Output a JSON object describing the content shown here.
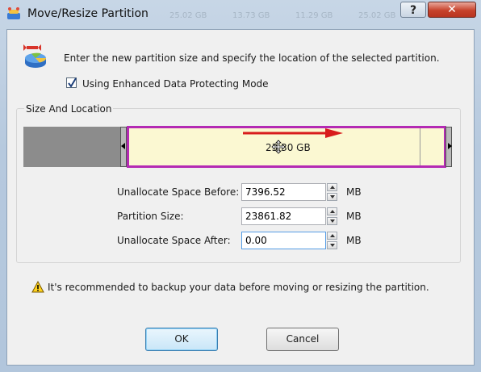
{
  "window": {
    "title": "Move/Resize Partition",
    "help_label": "?",
    "close_label": "✕",
    "background_ghost_values": [
      "25.02 GB",
      "13.73 GB",
      "11.29 GB",
      "25.02 GB"
    ]
  },
  "header": {
    "icon": "disk-move-icon",
    "instruction": "Enter the new partition size and specify the location of the selected partition."
  },
  "options": {
    "enhanced_mode_label": "Using Enhanced Data Protecting Mode",
    "enhanced_mode_checked": true
  },
  "size_location": {
    "group_title": "Size And Location",
    "partition_bar_label": "23.30 GB",
    "colors": {
      "unallocated": "#8c8c8c",
      "partition_fill": "#fbf8d2",
      "partition_border": "#b42ab4",
      "arrow": "#d81c1c"
    }
  },
  "fields": {
    "unalloc_before": {
      "label": "Unallocate Space Before:",
      "value": "7396.52",
      "unit": "MB"
    },
    "partition_size": {
      "label": "Partition Size:",
      "value": "23861.82",
      "unit": "MB"
    },
    "unalloc_after": {
      "label": "Unallocate Space After:",
      "value": "0.00",
      "unit": "MB"
    }
  },
  "warning": {
    "icon": "warning-icon",
    "text": "It's recommended to backup your data before moving or resizing the partition."
  },
  "buttons": {
    "ok": "OK",
    "cancel": "Cancel"
  }
}
